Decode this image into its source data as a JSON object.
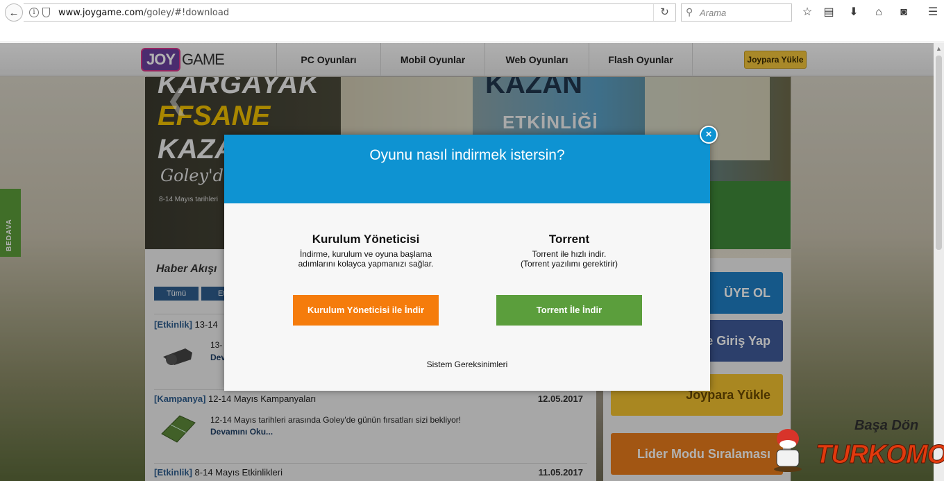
{
  "browser": {
    "url_host": "www.joygame.com",
    "url_path": "/goley/#!download",
    "search_placeholder": "Arama",
    "toolbar_icons": [
      "bookmark-star-icon",
      "reading-list-icon",
      "download-icon",
      "home-icon",
      "pocket-icon",
      "menu-icon"
    ]
  },
  "site": {
    "logo_joy": "JOY",
    "logo_game": "GAME",
    "nav": [
      {
        "label": "PC Oyunları"
      },
      {
        "label": "Mobil Oyunlar"
      },
      {
        "label": "Web Oyunları"
      },
      {
        "label": "Flash Oyunlar"
      }
    ],
    "joypara_button": "Joypara Yükle",
    "side_tab": "BEDAVA",
    "banner": {
      "line1": "KARGAYAK",
      "line2": "EFSANE",
      "line3": "KAZA",
      "line4": "Goley'de",
      "line5": "8-14 Mayıs tarihleri",
      "line6": "KAZAN",
      "line7": "ETKİNLİĞİ"
    },
    "news": {
      "heading": "Haber Akışı",
      "tabs": [
        "Tümü",
        "Etk"
      ],
      "items": [
        {
          "category": "[Etkinlik]",
          "title": "13-14",
          "date": "",
          "text": "13-",
          "more": "Dev"
        },
        {
          "category": "[Kampanya]",
          "title": "12-14 Mayıs Kampanyaları",
          "date": "12.05.2017",
          "text": "12-14 Mayıs tarihleri arasında Goley'de günün fırsatları sizi bekliyor!",
          "more": "Devamını Oku..."
        },
        {
          "category": "[Etkinlik]",
          "title": "8-14 Mayıs Etkinlikleri",
          "date": "11.05.2017",
          "text": "",
          "more": ""
        }
      ]
    },
    "right_buttons": [
      {
        "label": "ÜYE OL",
        "color": "#1f7fc4"
      },
      {
        "label": "e Giriş Yap",
        "color": "#3f5b9a"
      },
      {
        "label": "Joypara Yükle",
        "color": "#f2c230"
      },
      {
        "label": "Lider Modu Sıralaması",
        "color": "#e97c1c"
      }
    ]
  },
  "modal": {
    "title": "Oyunu nasıl indirmek istersin?",
    "close_label": "×",
    "left": {
      "title": "Kurulum Yöneticisi",
      "desc_line1": "İndirme, kurulum ve oyuna başlama",
      "desc_line2": "adımlarını kolayca yapmanızı sağlar.",
      "button": "Kurulum Yöneticisi ile İndir",
      "button_color": "#f57c0c"
    },
    "right": {
      "title": "Torrent",
      "desc_line1": "Torrent ile hızlı indir.",
      "desc_line2": "(Torrent yazılımı gerektirir)",
      "button": "Torrent İle İndir",
      "button_color": "#5b9e3c"
    },
    "system_requirements": "Sistem Gereksinimleri"
  },
  "watermark": {
    "top": "Başa Dön",
    "brand": "TURKOMO"
  }
}
